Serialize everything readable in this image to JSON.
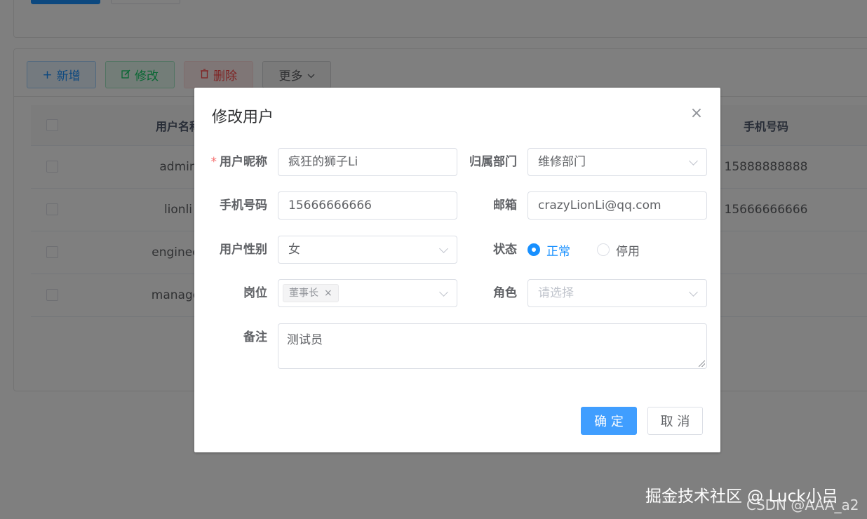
{
  "toolbar": {
    "add_label": "新增",
    "edit_label": "修改",
    "delete_label": "删除",
    "more_label": "更多"
  },
  "table": {
    "headers": {
      "username": "用户名称",
      "phone": "手机号码"
    },
    "rows": [
      {
        "username": "admin",
        "phone": "15888888888"
      },
      {
        "username": "lionli",
        "phone": "15666666666"
      },
      {
        "username": "engineer",
        "phone": ""
      },
      {
        "username": "manager",
        "phone": ""
      }
    ]
  },
  "dialog": {
    "title": "修改用户",
    "close_glyph": "×",
    "fields": {
      "nickname": {
        "label": "用户昵称",
        "required_mark": "*",
        "value": "疯狂的狮子Li"
      },
      "dept": {
        "label": "归属部门",
        "value": "维修部门"
      },
      "phone": {
        "label": "手机号码",
        "value": "15666666666"
      },
      "email": {
        "label": "邮箱",
        "value": "crazyLionLi@qq.com"
      },
      "gender": {
        "label": "用户性别",
        "value": "女"
      },
      "status": {
        "label": "状态",
        "options": [
          "正常",
          "停用"
        ],
        "selected": "正常"
      },
      "post": {
        "label": "岗位",
        "tags": [
          "董事长"
        ],
        "tag_close": "×"
      },
      "role": {
        "label": "角色",
        "placeholder": "请选择"
      },
      "remark": {
        "label": "备注",
        "value": "测试员"
      }
    },
    "confirm_label": "确 定",
    "cancel_label": "取 消"
  },
  "watermark": {
    "line1": "掘金技术社区 @ Luck小吕",
    "line2": "CSDN @AAA_a2"
  },
  "colors": {
    "primary": "#409eff",
    "required": "#f56c6c",
    "add": "#1890ff",
    "edit": "#13ce66",
    "delete": "#ff4949"
  }
}
